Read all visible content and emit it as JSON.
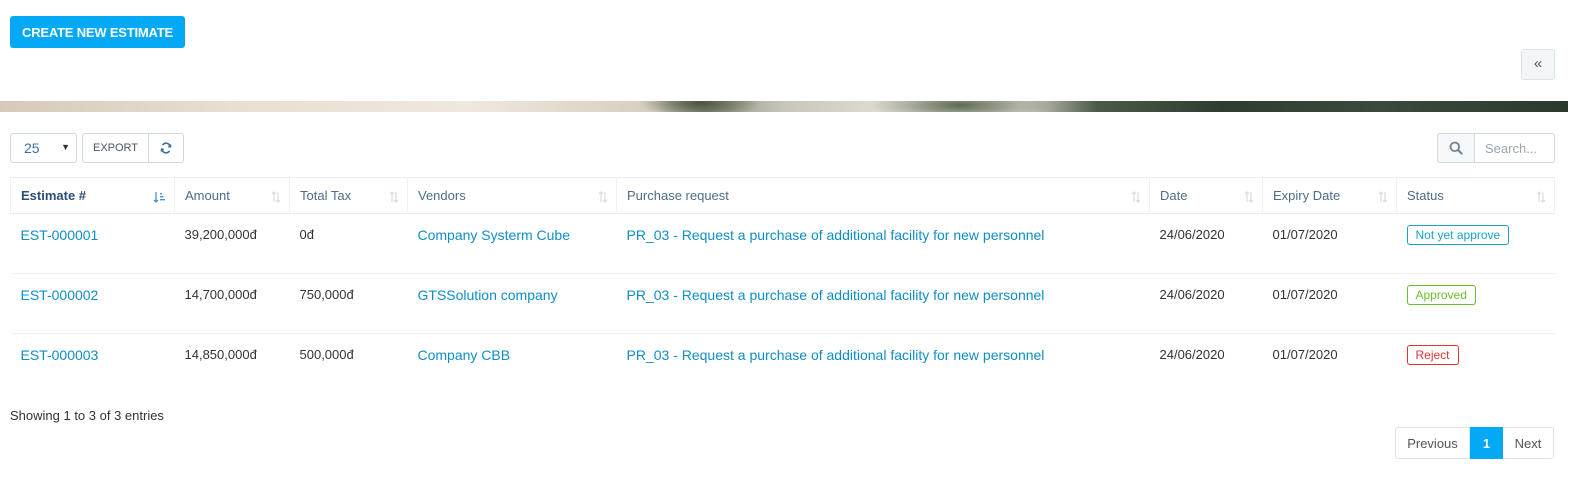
{
  "toolbar": {
    "create_label": "CREATE NEW ESTIMATE",
    "collapse_label": "«",
    "page_length": "25",
    "export_label": "EXPORT",
    "search_placeholder": "Search..."
  },
  "table": {
    "columns": [
      "Estimate #",
      "Amount",
      "Total Tax",
      "Vendors",
      "Purchase request",
      "Date",
      "Expiry Date",
      "Status"
    ],
    "rows": [
      {
        "estimate": "EST-000001",
        "amount": "39,200,000đ",
        "tax": "0đ",
        "vendor": "Company Systerm Cube",
        "purchase_request": "PR_03 - Request a purchase of additional facility for new personnel",
        "date": "24/06/2020",
        "expiry": "01/07/2020",
        "status": "Not yet approve"
      },
      {
        "estimate": "EST-000002",
        "amount": "14,700,000đ",
        "tax": "750,000đ",
        "vendor": "GTSSolution company",
        "purchase_request": "PR_03 - Request a purchase of additional facility for new personnel",
        "date": "24/06/2020",
        "expiry": "01/07/2020",
        "status": "Approved"
      },
      {
        "estimate": "EST-000003",
        "amount": "14,850,000đ",
        "tax": "500,000đ",
        "vendor": "Company CBB",
        "purchase_request": "PR_03 - Request a purchase of additional facility for new personnel",
        "date": "24/06/2020",
        "expiry": "01/07/2020",
        "status": "Reject"
      }
    ]
  },
  "footer": {
    "info": "Showing 1 to 3 of 3 entries",
    "previous": "Previous",
    "current_page": "1",
    "next": "Next"
  },
  "colors": {
    "primary": "#03a9f4",
    "link": "#0f8ec4",
    "status_pending": "#1aa3c2",
    "status_approved": "#6abf2c",
    "status_reject": "#e3342f"
  },
  "icons": {
    "refresh": "refresh-icon",
    "search": "search-icon",
    "sort": "sort-icon",
    "sort_active": "sort-ascending-icon",
    "collapse": "double-chevron-left-icon"
  }
}
